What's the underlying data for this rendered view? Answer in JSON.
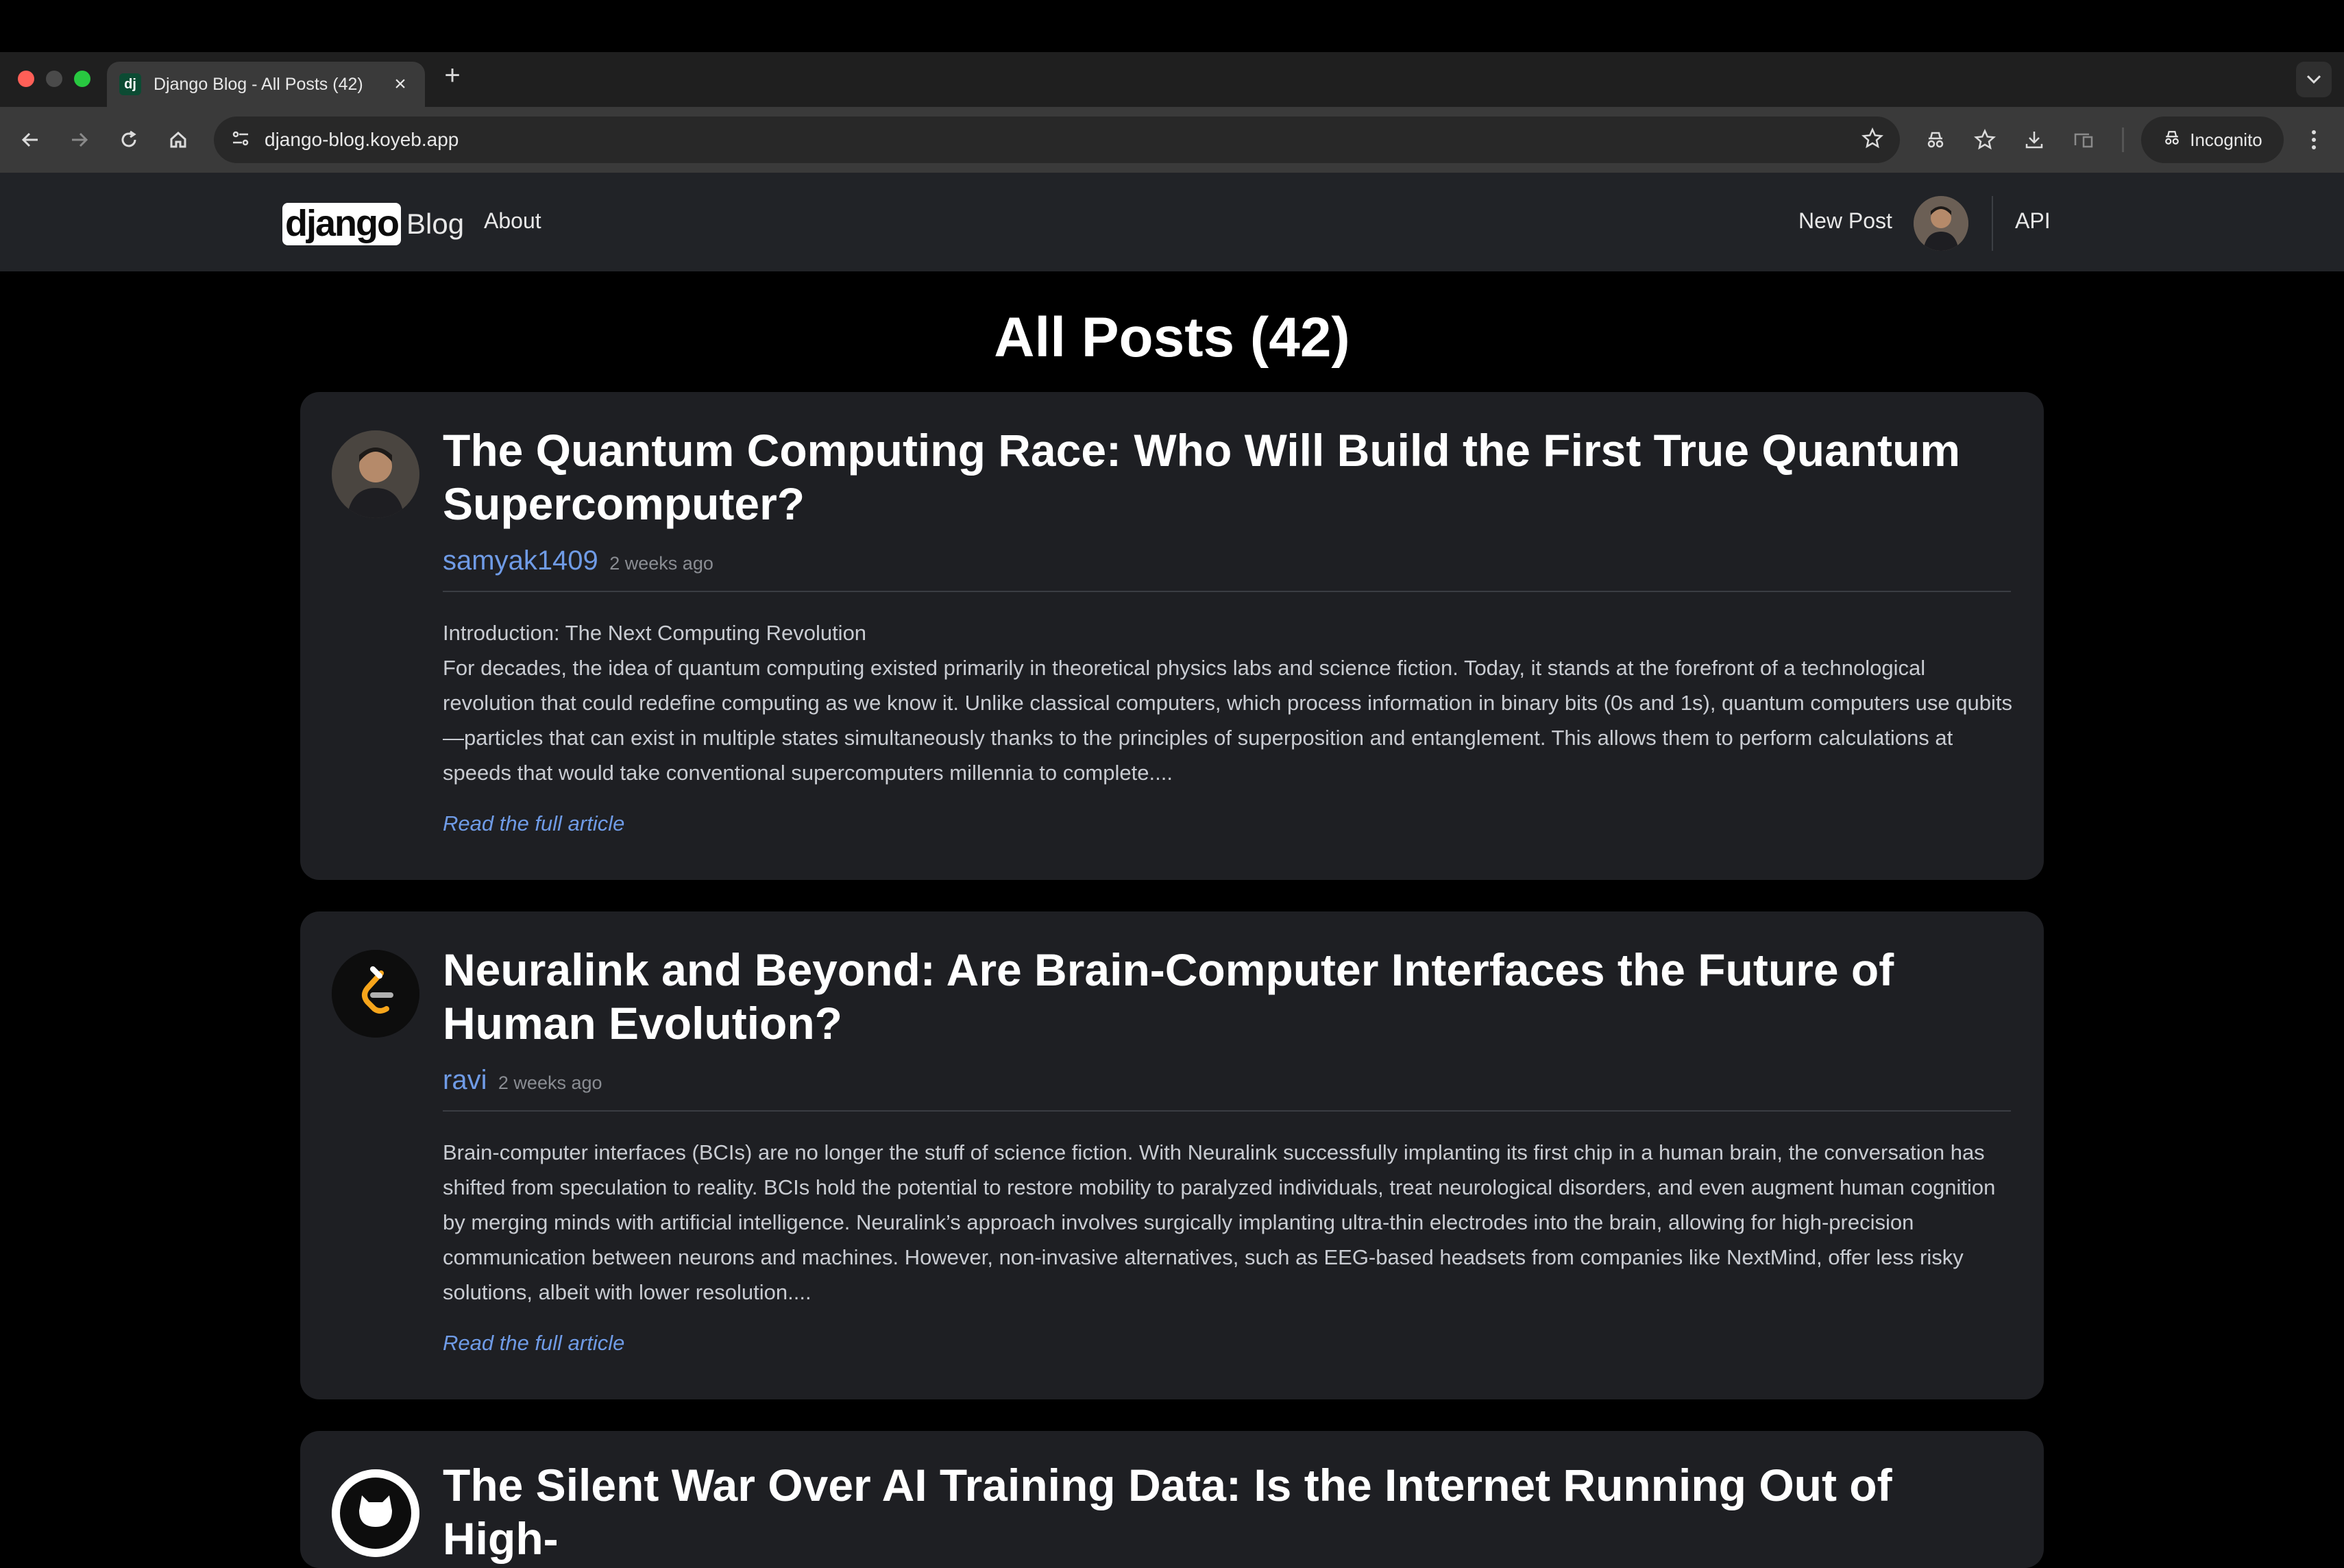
{
  "browser": {
    "tab": {
      "favicon": "dj",
      "title": "Django Blog - All Posts (42)",
      "close": "×"
    },
    "new_tab": "+",
    "url": "django-blog.koyeb.app",
    "incognito_label": "Incognito",
    "icons": [
      "back-icon",
      "forward-icon",
      "reload-icon",
      "home-icon",
      "site-info-icon",
      "bookmark-star-icon",
      "incognito-icon",
      "bookmarks-icon",
      "download-icon",
      "cast-icon",
      "menu-icon",
      "tab-search-icon"
    ]
  },
  "site": {
    "logo_text": "django",
    "logo_suffix": "Blog",
    "nav_about": "About",
    "nav_new_post": "New Post",
    "nav_api": "API"
  },
  "page": {
    "title": "All Posts (42)"
  },
  "posts": [
    {
      "title": "The Quantum Computing Race: Who Will Build the First True Quantum Supercomputer?",
      "author": "samyak1409",
      "date": "2 weeks ago",
      "body_line1": "Introduction: The Next Computing Revolution",
      "body_line2": "For decades, the idea of quantum computing existed primarily in theoretical physics labs and science fiction. Today, it stands at the forefront of a technological revolution that could redefine computing as we know it. Unlike classical computers, which process information in binary bits (0s and 1s), quantum computers use qubits—particles that can exist in multiple states simultaneously thanks to the principles of superposition and entanglement. This allows them to perform calculations at speeds that would take conventional supercomputers millennia to complete....",
      "read_more": "Read the full article"
    },
    {
      "title": "Neuralink and Beyond: Are Brain-Computer Interfaces the Future of Human Evolution?",
      "author": "ravi",
      "date": "2 weeks ago",
      "body": "Brain-computer interfaces (BCIs) are no longer the stuff of science fiction. With Neuralink successfully implanting its first chip in a human brain, the conversation has shifted from speculation to reality. BCIs hold the potential to restore mobility to paralyzed individuals, treat neurological disorders, and even augment human cognition by merging minds with artificial intelligence. Neuralink’s approach involves surgically implanting ultra-thin electrodes into the brain, allowing for high-precision communication between neurons and machines. However, non-invasive alternatives, such as EEG-based headsets from companies like NextMind, offer less risky solutions, albeit with lower resolution....",
      "read_more": "Read the full article"
    },
    {
      "title": "The Silent War Over AI Training Data: Is the Internet Running Out of High-"
    }
  ],
  "colors": {
    "accent": "#6f9be6",
    "card_bg": "#1e1f23",
    "navbar_bg": "#212327"
  }
}
